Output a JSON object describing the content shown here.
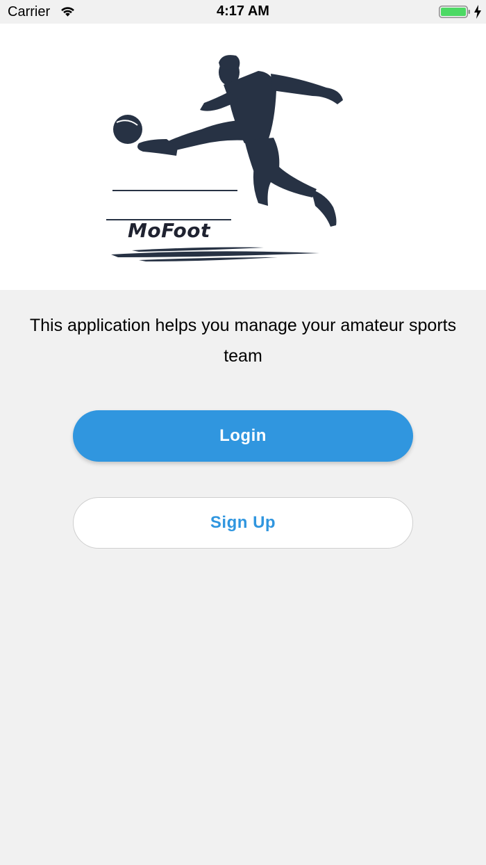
{
  "status_bar": {
    "carrier": "Carrier",
    "time": "4:17 AM",
    "battery_color": "#4cd964"
  },
  "hero": {
    "brand_name": "MoFoot",
    "ink_color": "#273244"
  },
  "description": "This application helps you manage your amateur sports team",
  "buttons": {
    "login_label": "Login",
    "signup_label": "Sign Up",
    "accent_color": "#3096df"
  }
}
